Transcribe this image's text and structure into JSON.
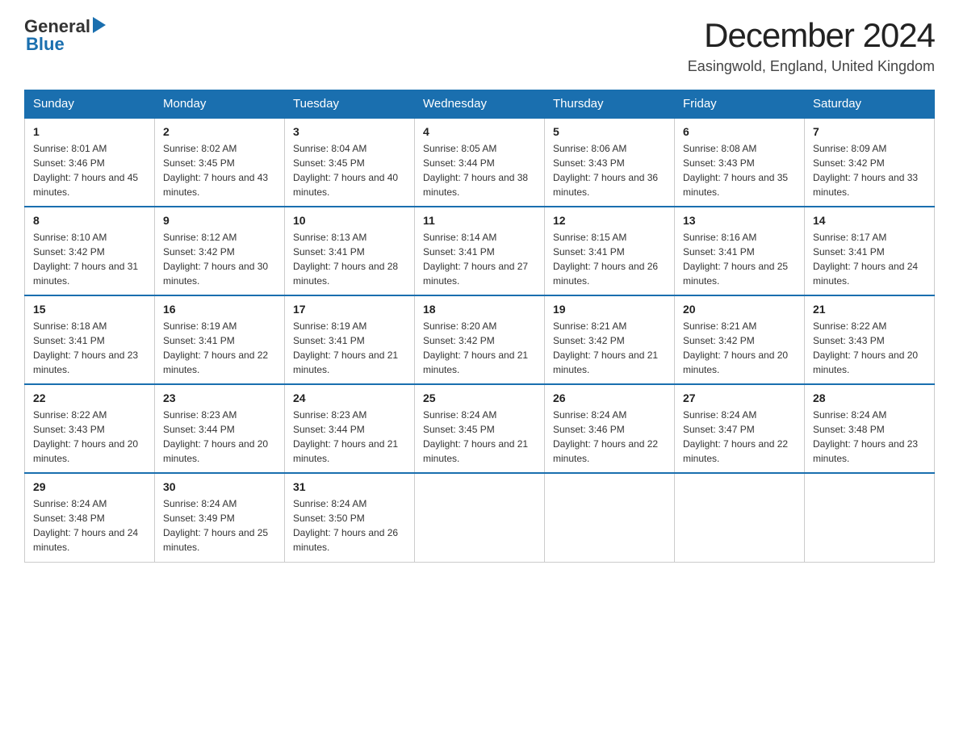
{
  "header": {
    "logo_general": "General",
    "logo_blue": "Blue",
    "title": "December 2024",
    "subtitle": "Easingwold, England, United Kingdom"
  },
  "days_of_week": [
    "Sunday",
    "Monday",
    "Tuesday",
    "Wednesday",
    "Thursday",
    "Friday",
    "Saturday"
  ],
  "weeks": [
    [
      {
        "day": "1",
        "sunrise": "8:01 AM",
        "sunset": "3:46 PM",
        "daylight": "7 hours and 45 minutes."
      },
      {
        "day": "2",
        "sunrise": "8:02 AM",
        "sunset": "3:45 PM",
        "daylight": "7 hours and 43 minutes."
      },
      {
        "day": "3",
        "sunrise": "8:04 AM",
        "sunset": "3:45 PM",
        "daylight": "7 hours and 40 minutes."
      },
      {
        "day": "4",
        "sunrise": "8:05 AM",
        "sunset": "3:44 PM",
        "daylight": "7 hours and 38 minutes."
      },
      {
        "day": "5",
        "sunrise": "8:06 AM",
        "sunset": "3:43 PM",
        "daylight": "7 hours and 36 minutes."
      },
      {
        "day": "6",
        "sunrise": "8:08 AM",
        "sunset": "3:43 PM",
        "daylight": "7 hours and 35 minutes."
      },
      {
        "day": "7",
        "sunrise": "8:09 AM",
        "sunset": "3:42 PM",
        "daylight": "7 hours and 33 minutes."
      }
    ],
    [
      {
        "day": "8",
        "sunrise": "8:10 AM",
        "sunset": "3:42 PM",
        "daylight": "7 hours and 31 minutes."
      },
      {
        "day": "9",
        "sunrise": "8:12 AM",
        "sunset": "3:42 PM",
        "daylight": "7 hours and 30 minutes."
      },
      {
        "day": "10",
        "sunrise": "8:13 AM",
        "sunset": "3:41 PM",
        "daylight": "7 hours and 28 minutes."
      },
      {
        "day": "11",
        "sunrise": "8:14 AM",
        "sunset": "3:41 PM",
        "daylight": "7 hours and 27 minutes."
      },
      {
        "day": "12",
        "sunrise": "8:15 AM",
        "sunset": "3:41 PM",
        "daylight": "7 hours and 26 minutes."
      },
      {
        "day": "13",
        "sunrise": "8:16 AM",
        "sunset": "3:41 PM",
        "daylight": "7 hours and 25 minutes."
      },
      {
        "day": "14",
        "sunrise": "8:17 AM",
        "sunset": "3:41 PM",
        "daylight": "7 hours and 24 minutes."
      }
    ],
    [
      {
        "day": "15",
        "sunrise": "8:18 AM",
        "sunset": "3:41 PM",
        "daylight": "7 hours and 23 minutes."
      },
      {
        "day": "16",
        "sunrise": "8:19 AM",
        "sunset": "3:41 PM",
        "daylight": "7 hours and 22 minutes."
      },
      {
        "day": "17",
        "sunrise": "8:19 AM",
        "sunset": "3:41 PM",
        "daylight": "7 hours and 21 minutes."
      },
      {
        "day": "18",
        "sunrise": "8:20 AM",
        "sunset": "3:42 PM",
        "daylight": "7 hours and 21 minutes."
      },
      {
        "day": "19",
        "sunrise": "8:21 AM",
        "sunset": "3:42 PM",
        "daylight": "7 hours and 21 minutes."
      },
      {
        "day": "20",
        "sunrise": "8:21 AM",
        "sunset": "3:42 PM",
        "daylight": "7 hours and 20 minutes."
      },
      {
        "day": "21",
        "sunrise": "8:22 AM",
        "sunset": "3:43 PM",
        "daylight": "7 hours and 20 minutes."
      }
    ],
    [
      {
        "day": "22",
        "sunrise": "8:22 AM",
        "sunset": "3:43 PM",
        "daylight": "7 hours and 20 minutes."
      },
      {
        "day": "23",
        "sunrise": "8:23 AM",
        "sunset": "3:44 PM",
        "daylight": "7 hours and 20 minutes."
      },
      {
        "day": "24",
        "sunrise": "8:23 AM",
        "sunset": "3:44 PM",
        "daylight": "7 hours and 21 minutes."
      },
      {
        "day": "25",
        "sunrise": "8:24 AM",
        "sunset": "3:45 PM",
        "daylight": "7 hours and 21 minutes."
      },
      {
        "day": "26",
        "sunrise": "8:24 AM",
        "sunset": "3:46 PM",
        "daylight": "7 hours and 22 minutes."
      },
      {
        "day": "27",
        "sunrise": "8:24 AM",
        "sunset": "3:47 PM",
        "daylight": "7 hours and 22 minutes."
      },
      {
        "day": "28",
        "sunrise": "8:24 AM",
        "sunset": "3:48 PM",
        "daylight": "7 hours and 23 minutes."
      }
    ],
    [
      {
        "day": "29",
        "sunrise": "8:24 AM",
        "sunset": "3:48 PM",
        "daylight": "7 hours and 24 minutes."
      },
      {
        "day": "30",
        "sunrise": "8:24 AM",
        "sunset": "3:49 PM",
        "daylight": "7 hours and 25 minutes."
      },
      {
        "day": "31",
        "sunrise": "8:24 AM",
        "sunset": "3:50 PM",
        "daylight": "7 hours and 26 minutes."
      },
      null,
      null,
      null,
      null
    ]
  ],
  "labels": {
    "sunrise": "Sunrise:",
    "sunset": "Sunset:",
    "daylight": "Daylight:"
  },
  "colors": {
    "header_bg": "#1a6faf",
    "header_text": "#ffffff",
    "border": "#cccccc"
  }
}
